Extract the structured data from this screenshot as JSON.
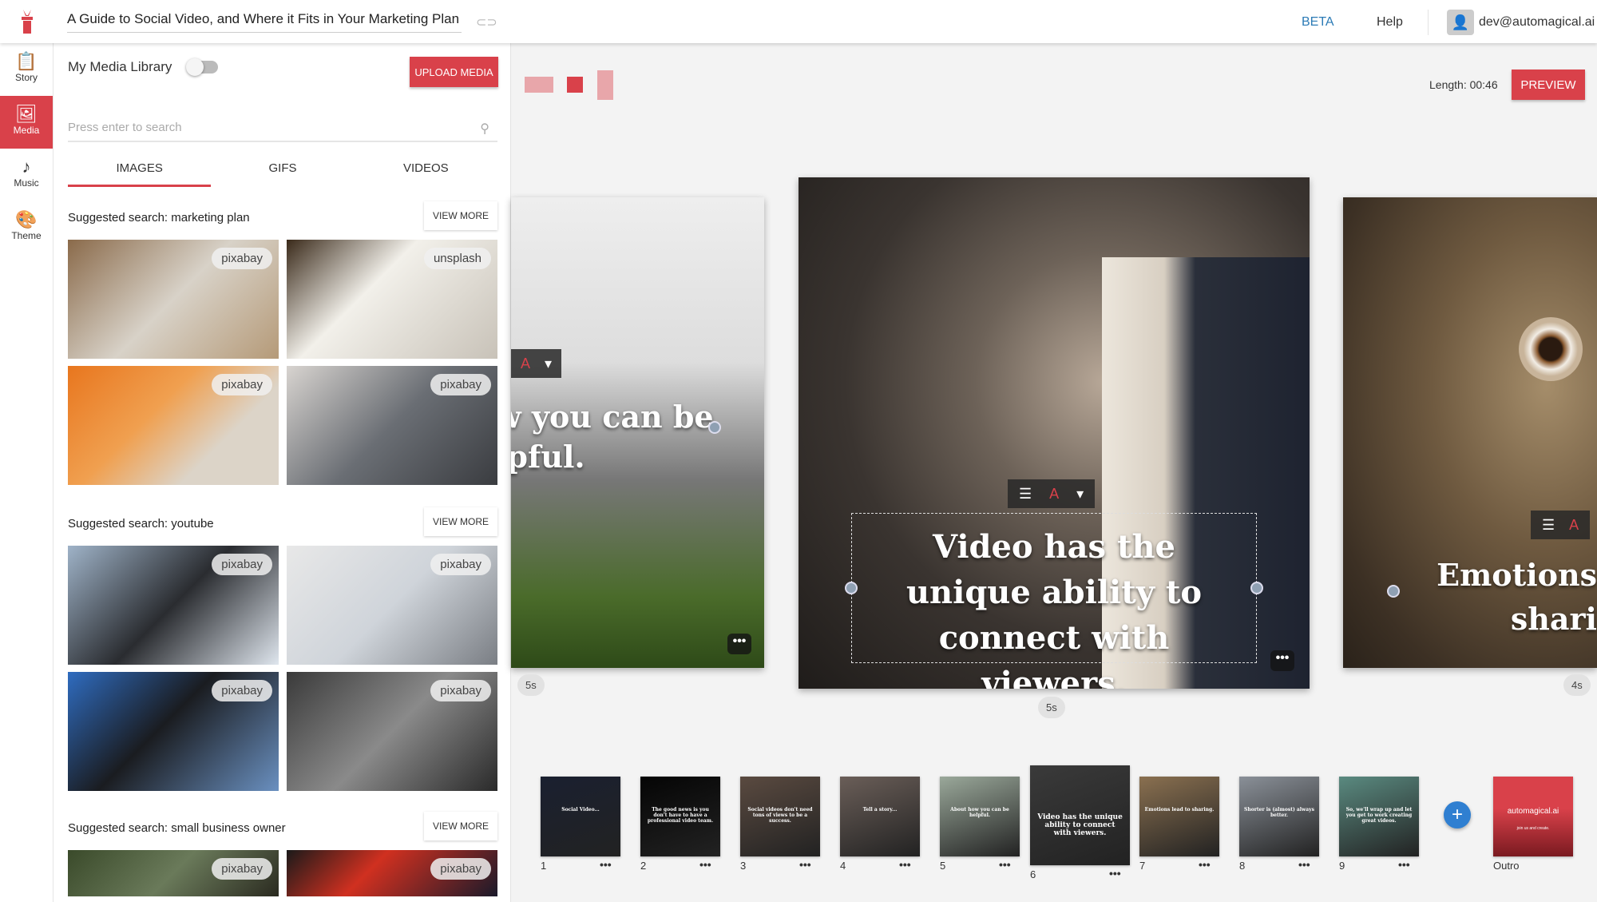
{
  "header": {
    "title": "A Guide to Social Video, and Where it Fits in Your Marketing Plan",
    "beta": "BETA",
    "help": "Help",
    "user": "dev@automagical.ai"
  },
  "nav": [
    {
      "label": "Story",
      "icon": "clipboard-icon"
    },
    {
      "label": "Media",
      "icon": "image-icon"
    },
    {
      "label": "Music",
      "icon": "music-icon"
    },
    {
      "label": "Theme",
      "icon": "palette-icon"
    }
  ],
  "panel": {
    "library_label": "My Media Library",
    "library_toggle_on": false,
    "upload_label": "UPLOAD MEDIA",
    "search_placeholder": "Press enter to search",
    "tabs": [
      "IMAGES",
      "GIFS",
      "VIDEOS"
    ],
    "active_tab": "IMAGES",
    "view_more": "VIEW MORE",
    "sections": [
      {
        "title": "Suggested search: marketing plan",
        "images": [
          {
            "source": "pixabay"
          },
          {
            "source": "unsplash"
          },
          {
            "source": "pixabay"
          },
          {
            "source": "pixabay"
          }
        ]
      },
      {
        "title": "Suggested search: youtube",
        "images": [
          {
            "source": "pixabay"
          },
          {
            "source": "pixabay"
          },
          {
            "source": "pixabay"
          },
          {
            "source": "pixabay"
          }
        ]
      },
      {
        "title": "Suggested search: small business owner",
        "images": [
          {
            "source": "pixabay"
          },
          {
            "source": "pixabay"
          }
        ]
      }
    ]
  },
  "editor": {
    "length": "Length: 00:46",
    "preview_label": "PREVIEW",
    "prev_slide": {
      "text": "w you can be\nlpful.",
      "duration": "5s"
    },
    "current_slide": {
      "text": "Video has the unique ability to connect with viewers.",
      "duration": "5s"
    },
    "next_slide": {
      "text": "Emotions\nshari",
      "duration": "4s"
    },
    "more": "•••"
  },
  "filmstrip": [
    {
      "num": "1",
      "text": "Social Video..."
    },
    {
      "num": "2",
      "text": "The good news is you don't have to have a professional video team."
    },
    {
      "num": "3",
      "text": "Social videos don't need tons of views to be a success."
    },
    {
      "num": "4",
      "text": "Tell a story..."
    },
    {
      "num": "5",
      "text": "About how you can be helpful."
    },
    {
      "num": "6",
      "text": "Video has the unique ability to connect with viewers."
    },
    {
      "num": "7",
      "text": "Emotions lead to sharing."
    },
    {
      "num": "8",
      "text": "Shorter is (almost) always better."
    },
    {
      "num": "9",
      "text": "So, we'll wrap up and let you get to work creating great videos."
    }
  ],
  "outro": {
    "label": "Outro",
    "brand": "automagical.ai",
    "tagline": "join us and create."
  },
  "colors": {
    "accent": "#d9414a",
    "link": "#2c7bb6",
    "add": "#2f7fd1"
  }
}
